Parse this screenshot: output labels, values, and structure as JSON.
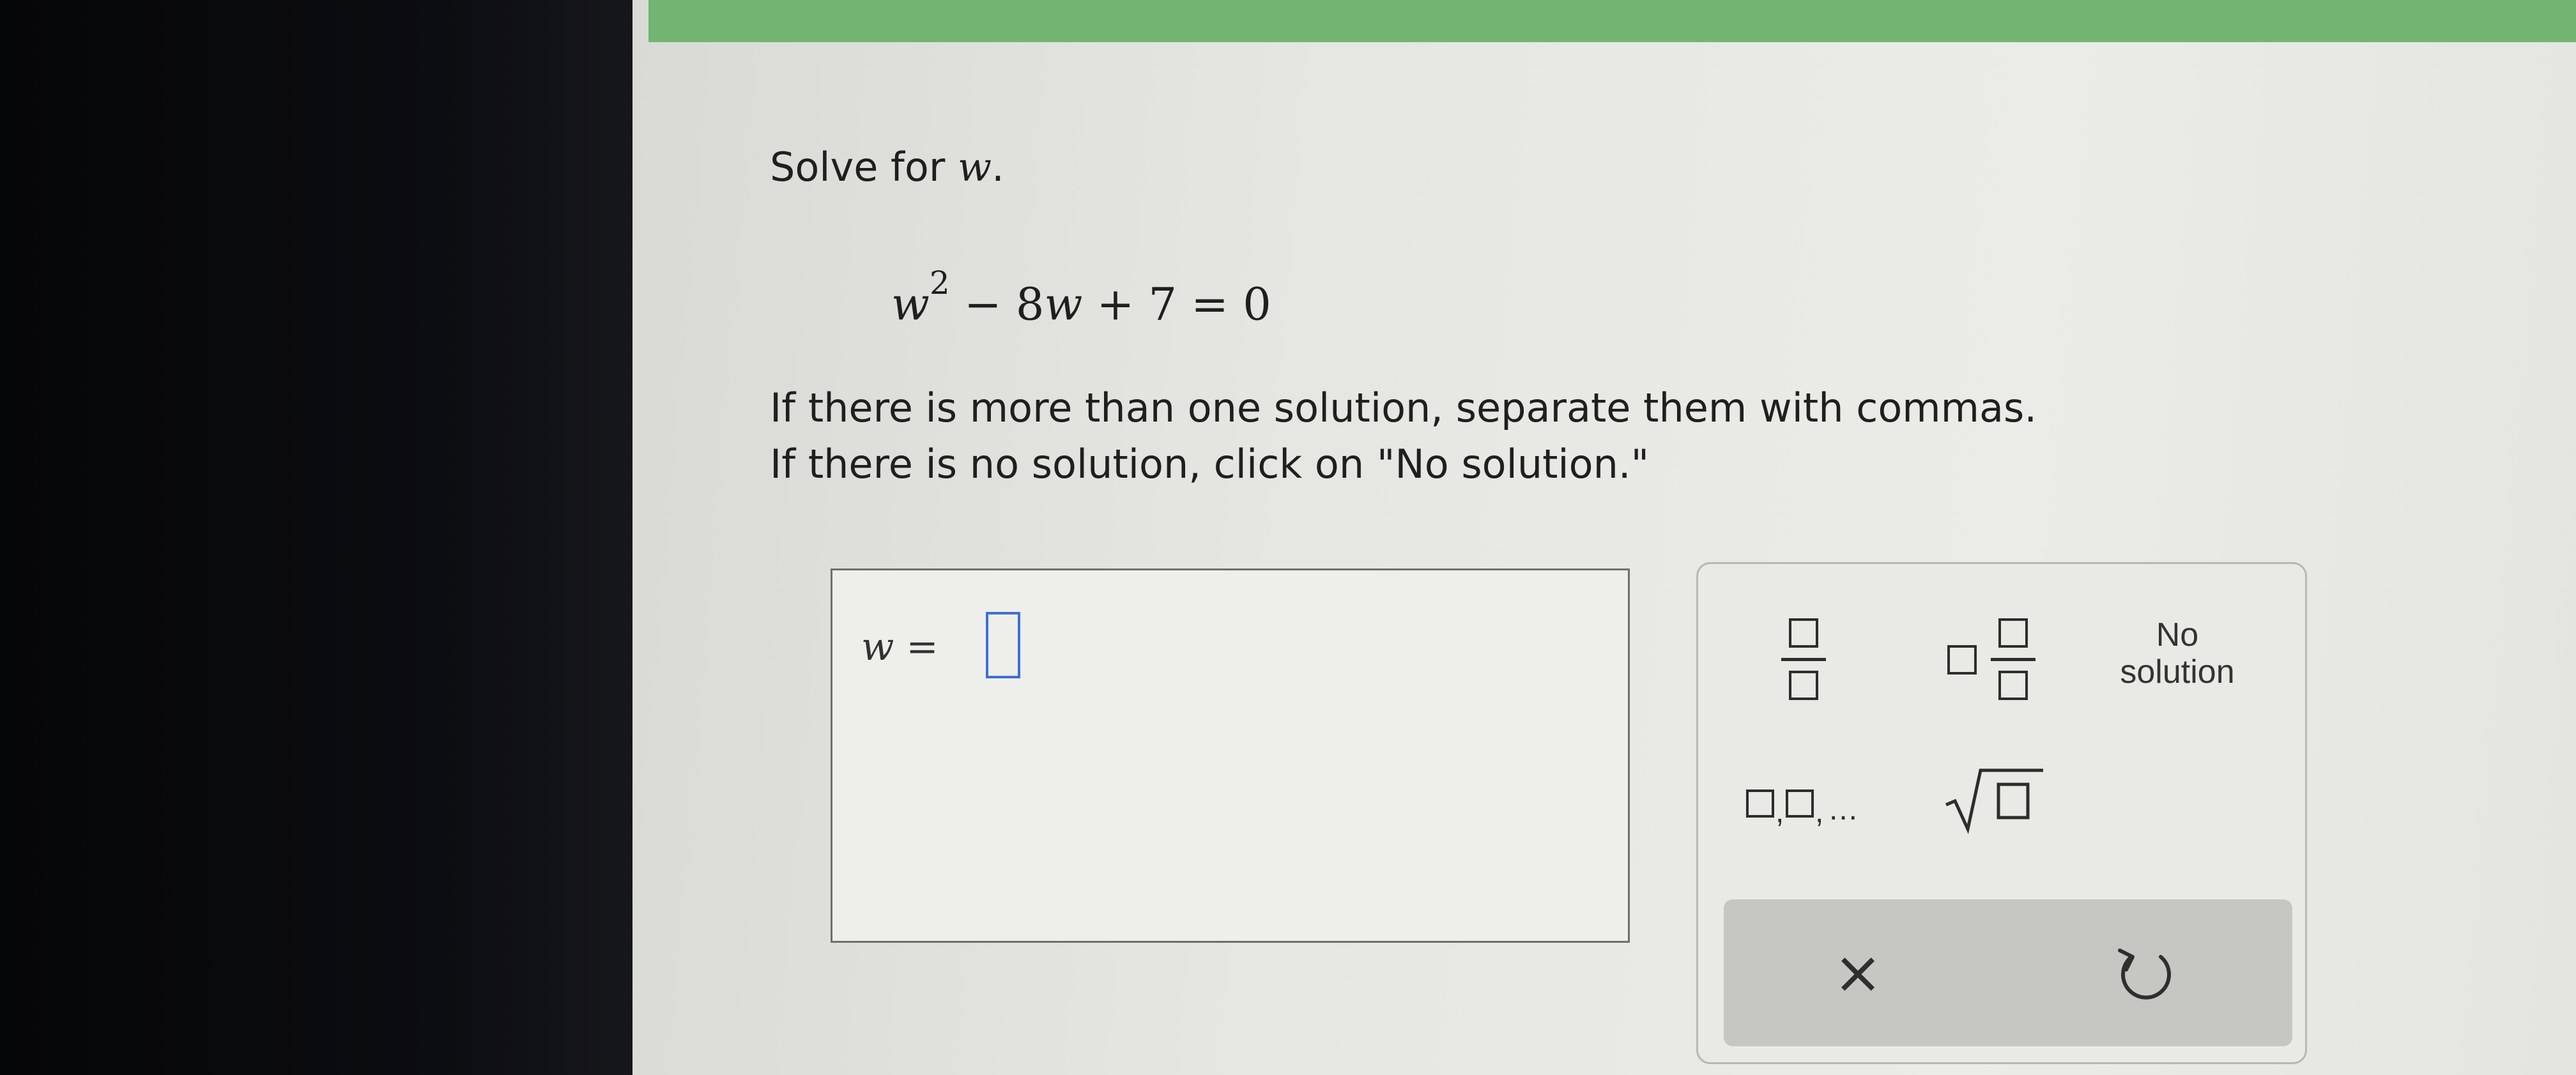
{
  "problem": {
    "title_prefix": "Solve for",
    "title_var": "w",
    "title_suffix": ".",
    "equation": {
      "var": "w",
      "exponent": "2",
      "rest": " − 8",
      "mid_var": "w",
      "tail": " + 7 = 0"
    },
    "instructions": [
      "If there is more than one solution, separate them with commas.",
      "If there is no solution, click on \"No solution.\""
    ]
  },
  "answer": {
    "var": "w",
    "equals": " =",
    "value": ""
  },
  "keypad": {
    "no_solution_line1": "No",
    "no_solution_line2": "solution",
    "list_dots": "...",
    "clear_symbol": "×"
  },
  "colors": {
    "header_green": "#72b572",
    "input_border": "#3d6fd6",
    "text": "#1f1f1f"
  },
  "icons": {
    "fraction": "fraction-template-icon",
    "mixed_number": "mixed-number-template-icon",
    "list": "list-template-icon",
    "sqrt": "square-root-icon",
    "clear": "close-icon",
    "undo": "undo-icon"
  }
}
